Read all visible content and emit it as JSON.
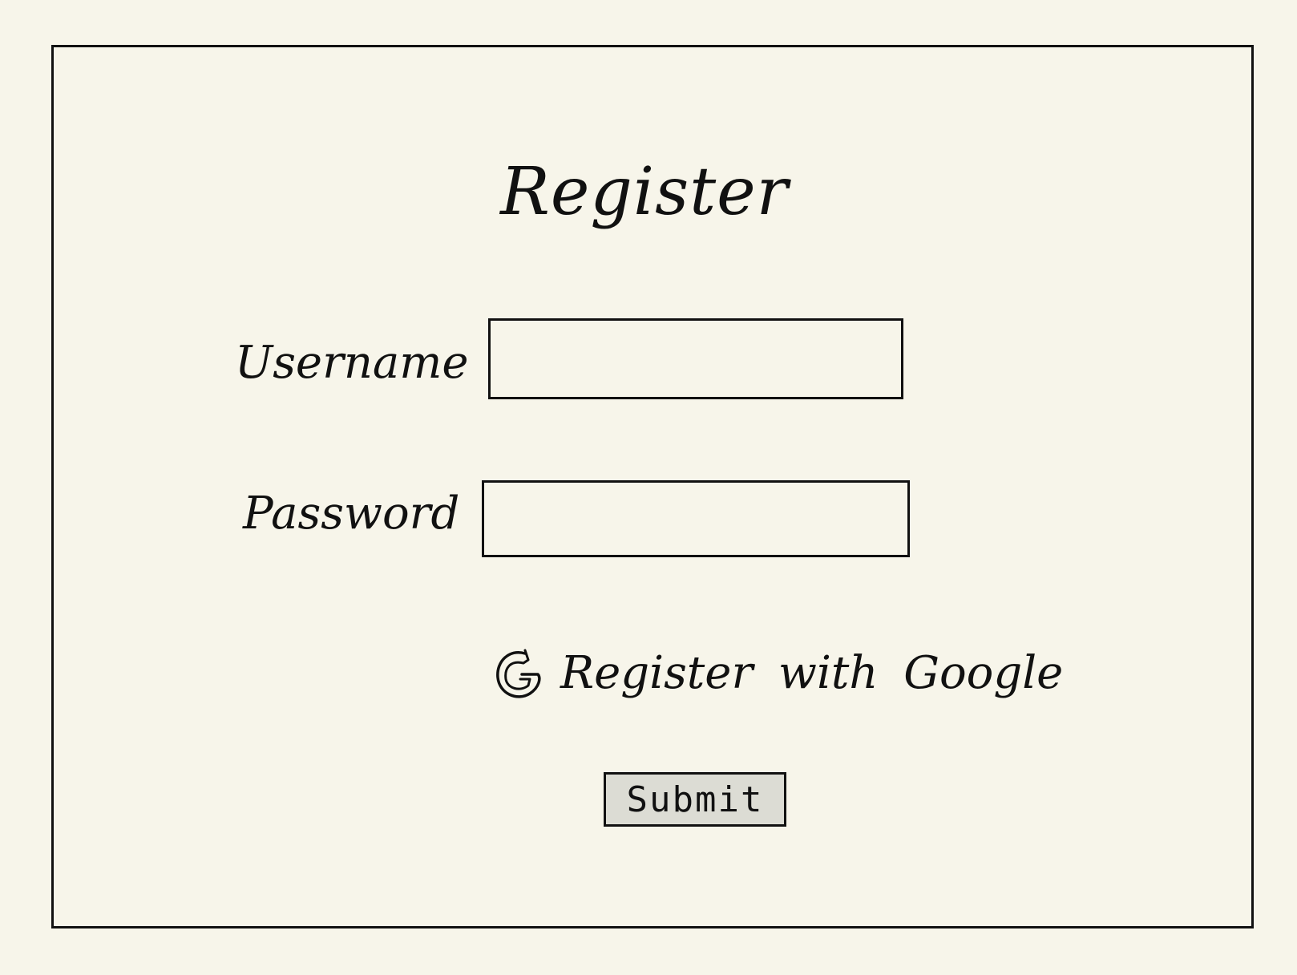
{
  "form": {
    "title": "Register",
    "username_label": "Username",
    "username_value": "",
    "password_label": "Password",
    "password_value": "",
    "google_label": "Register with Google",
    "google_icon": "google-g-icon",
    "submit_label": "Submit"
  },
  "colors": {
    "background": "#f7f5ea",
    "stroke": "#111111",
    "button_fill": "#dcdcd4"
  }
}
